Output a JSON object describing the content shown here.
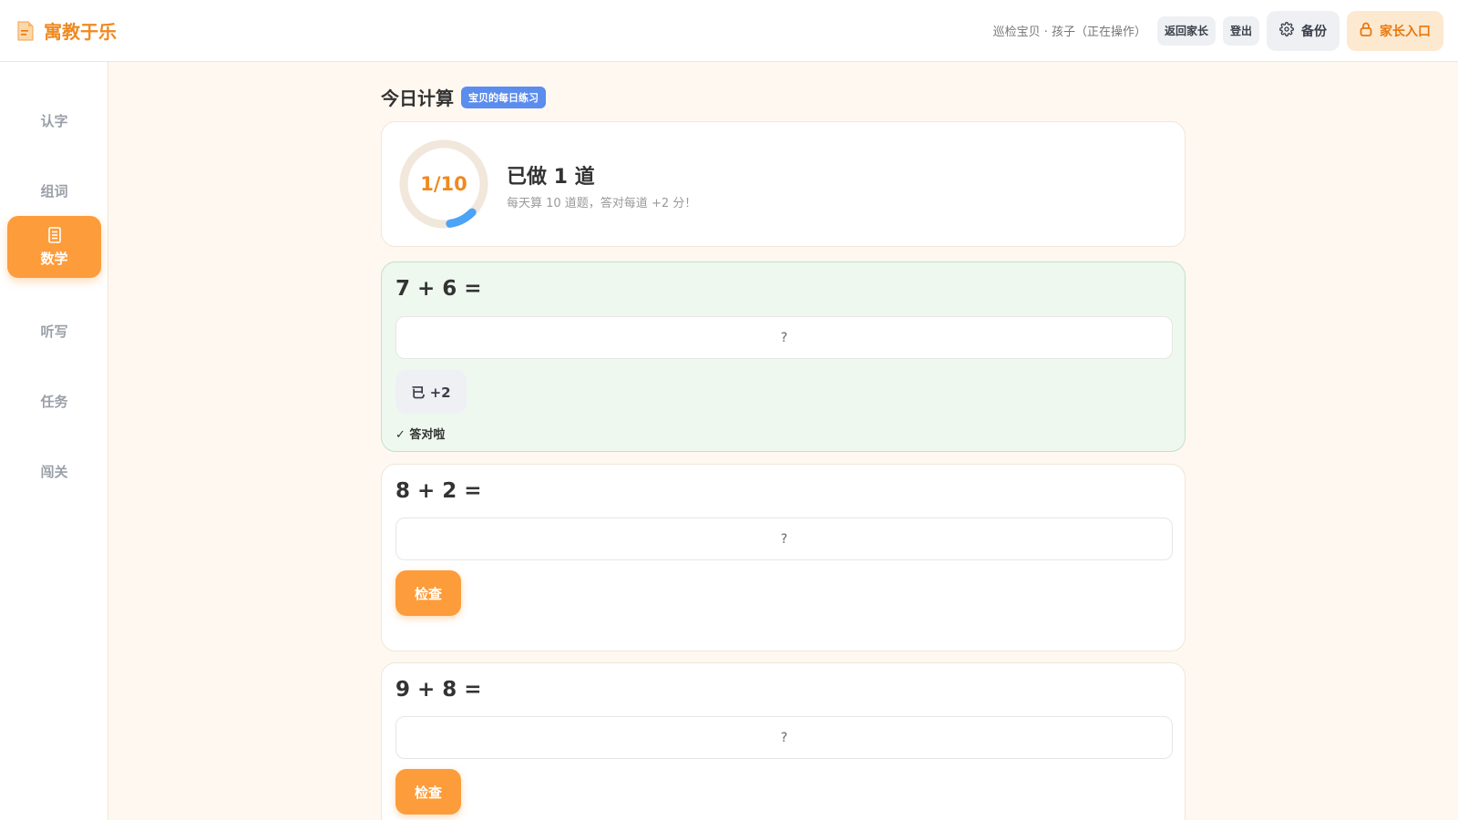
{
  "header": {
    "brand": "寓教于乐",
    "user_info": "巡检宝贝 · 孩子（正在操作）",
    "back_parent_label": "返回家长",
    "logout_label": "登出",
    "backup_label": "备份",
    "parent_entry_label": "家长入口"
  },
  "sidebar": {
    "items": [
      {
        "label": "认字"
      },
      {
        "label": "组词"
      },
      {
        "label": "数学",
        "active": true
      },
      {
        "label": "听写"
      },
      {
        "label": "任务"
      },
      {
        "label": "闯关"
      }
    ]
  },
  "main": {
    "title": "今日计算",
    "badge": "宝贝的每日练习",
    "progress": {
      "text": "1/10",
      "done": 1,
      "total": 10,
      "title": "已做 1 道",
      "subtitle": "每天算 10 道题，答对每道 +2 分！"
    },
    "questions": [
      {
        "text": "7 + 6 =",
        "placeholder": "?",
        "status": "done",
        "done_label": "已 +2",
        "result": "✓ 答对啦"
      },
      {
        "text": "8 + 2 =",
        "placeholder": "?",
        "status": "pending",
        "check_label": "检查"
      },
      {
        "text": "9 + 8 =",
        "placeholder": "?",
        "status": "pending",
        "check_label": "检查"
      }
    ]
  },
  "colors": {
    "accent": "#fd9c3b",
    "brand": "#f0891f",
    "progress_ring": "#4da3f5",
    "badge": "#5b8dee",
    "correct_bg": "#eef8ef"
  }
}
